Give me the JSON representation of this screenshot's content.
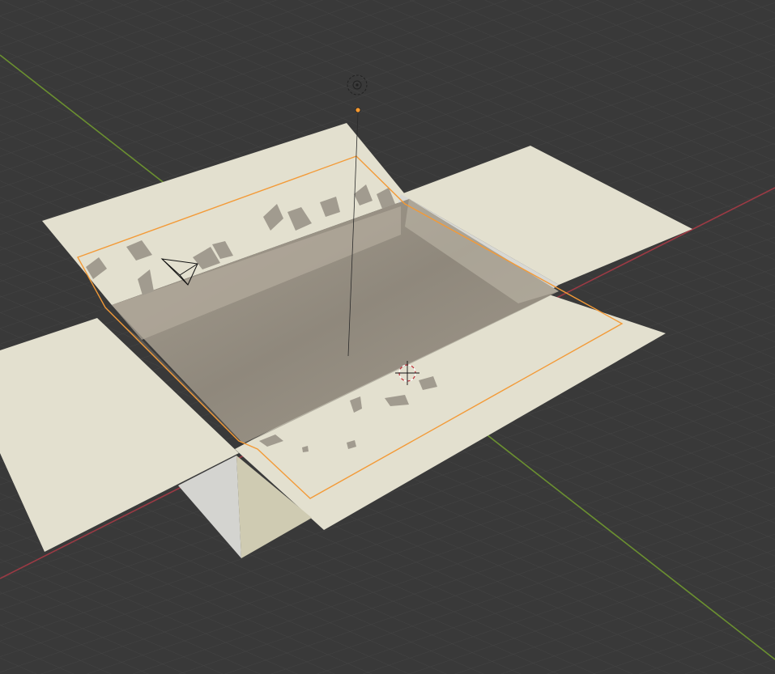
{
  "app": {
    "area": "3d-viewport",
    "shading": "solid"
  },
  "colors": {
    "background": "#393939",
    "grid_line": "#444444",
    "x_axis": "#9b3a44",
    "y_axis": "#6b9030",
    "mesh_surface": "#e3e0cf",
    "mesh_side": "#cfcbb2",
    "mesh_recess": "#9c9282",
    "selection_outline": "#f39a37",
    "light_origin": "#ff9b2f"
  },
  "objects": [
    {
      "name": "box-mesh",
      "selected": true
    },
    {
      "name": "camera",
      "selected": false
    },
    {
      "name": "light",
      "selected": false
    },
    {
      "name": "3d-cursor",
      "selected": false
    }
  ]
}
